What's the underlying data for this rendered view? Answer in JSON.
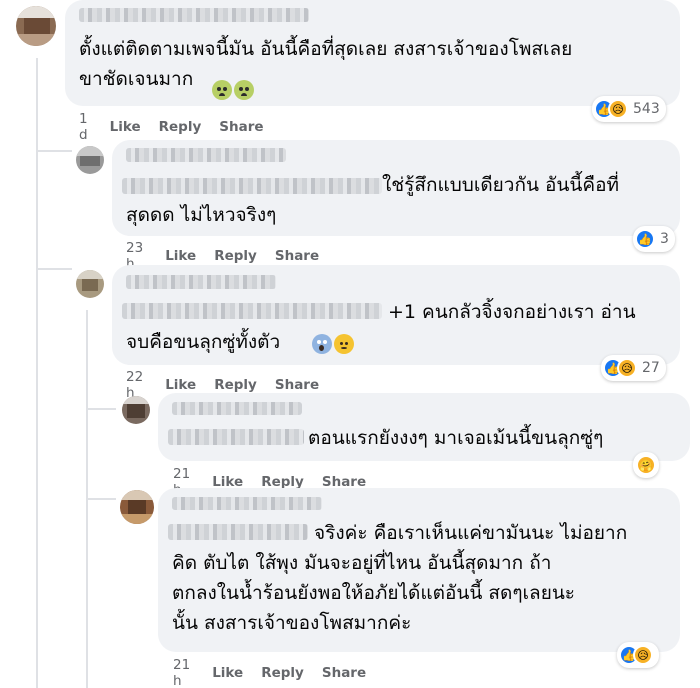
{
  "accent_color": "#1877f2",
  "comments": [
    {
      "text": "ตั้งแต่ติดตามเพจนี้มัน อันนี้คือที่สุดเลย สงสารเจ้าของโพสเลย\nขาชัดเจนมาก",
      "emojis": [
        "sick-emoji",
        "sick-emoji"
      ],
      "time": "1 d",
      "actions": [
        "Like",
        "Reply",
        "Share"
      ],
      "reactions": [
        "like-icon",
        "sad-icon"
      ],
      "reaction_count": "543"
    },
    {
      "text": "ใช่รู้สึกแบบเดียวกัน อันนี้คือที่\nสุดดด ไม่ไหวจริงๆ",
      "time": "23 h",
      "actions": [
        "Like",
        "Reply",
        "Share"
      ],
      "reactions": [
        "like-icon"
      ],
      "reaction_count": "3"
    },
    {
      "text": "+1 คนกลัวจิ้งจกอย่างเรา อ่าน\nจบคือขนลุกซู่ทั้งตัว",
      "emojis": [
        "screaming-emoji",
        "sweat-emoji"
      ],
      "time": "22 h",
      "actions": [
        "Like",
        "Reply",
        "Share"
      ],
      "reactions": [
        "like-icon",
        "sad-icon"
      ],
      "reaction_count": "27"
    },
    {
      "text": "ตอนแรกยังงงๆ มาเจอเม้นนี้ขนลุกซู่ๆ",
      "time": "21 h",
      "actions": [
        "Like",
        "Reply",
        "Share"
      ],
      "reactions": [
        "care-icon"
      ],
      "reaction_count": ""
    },
    {
      "text": "จริงค่ะ คือเราเห็นแค่ขามันนะ ไม่อยาก\nคิด ตับไต ใส้พุง มันจะอยู่ที่ไหน อันนี้สุดมาก ถ้า\nตกลงในน้ำร้อนยังพอให้อภัยได้แต่อันนี้ สดๆเลยนะ\nนั้น สงสารเจ้าของโพสมากค่ะ",
      "time": "21 h",
      "actions": [
        "Like",
        "Reply",
        "Share"
      ],
      "reactions": [
        "like-icon",
        "sad-icon"
      ],
      "reaction_count": ""
    }
  ]
}
